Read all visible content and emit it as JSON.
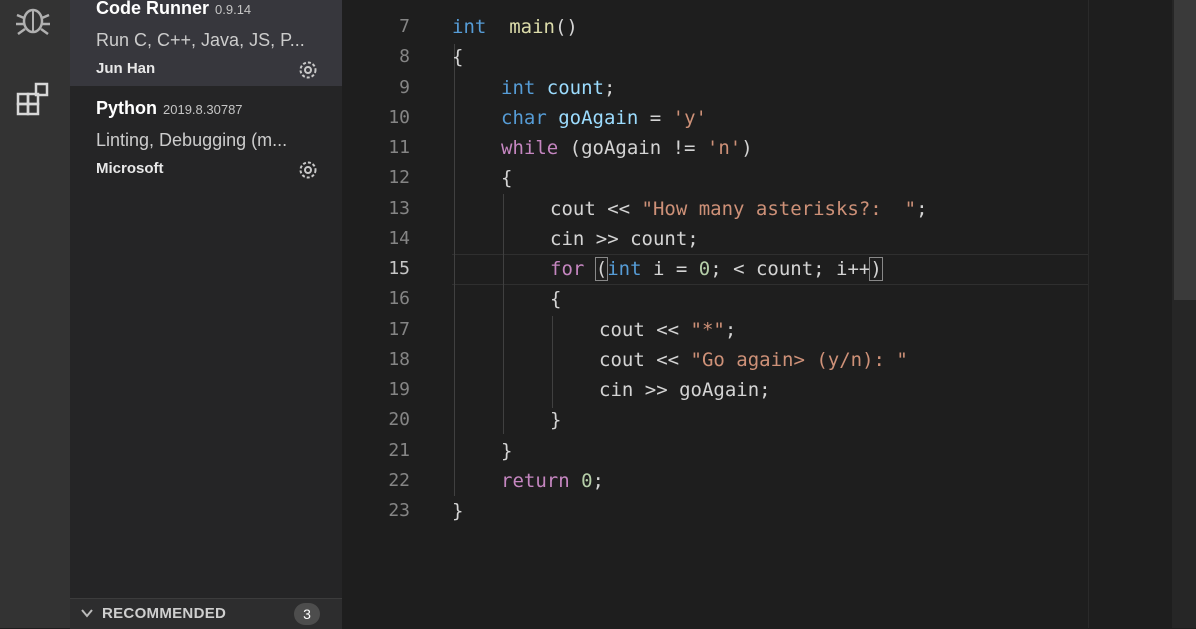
{
  "sidebar": {
    "extensions": [
      {
        "name": "Code Runner",
        "version": "0.9.14",
        "description": "Run C, C++, Java, JS, P...",
        "publisher": "Jun Han"
      },
      {
        "name": "Python",
        "version": "2019.8.30787",
        "description": "Linting, Debugging (m...",
        "publisher": "Microsoft"
      }
    ],
    "recommended": {
      "label": "RECOMMENDED",
      "count": "3"
    }
  },
  "editor": {
    "active_line": 15,
    "lines": [
      {
        "num": "7",
        "indent": 0,
        "tokens": [
          [
            "kw",
            "int"
          ],
          [
            "",
            "  "
          ],
          [
            "fn",
            "main"
          ],
          [
            "",
            "()"
          ]
        ]
      },
      {
        "num": "8",
        "indent": 0,
        "tokens": [
          [
            "",
            "{"
          ]
        ]
      },
      {
        "num": "9",
        "indent": 1,
        "tokens": [
          [
            "kw",
            "int"
          ],
          [
            "",
            " "
          ],
          [
            "var",
            "count"
          ],
          [
            "",
            ";"
          ]
        ]
      },
      {
        "num": "10",
        "indent": 1,
        "tokens": [
          [
            "kw",
            "char"
          ],
          [
            "",
            " "
          ],
          [
            "var",
            "goAgain"
          ],
          [
            "",
            " = "
          ],
          [
            "str",
            "'y'"
          ]
        ]
      },
      {
        "num": "11",
        "indent": 1,
        "tokens": [
          [
            "kw2",
            "while"
          ],
          [
            "",
            " (goAgain != "
          ],
          [
            "str",
            "'n'"
          ],
          [
            "",
            ")"
          ]
        ]
      },
      {
        "num": "12",
        "indent": 1,
        "tokens": [
          [
            "",
            "{"
          ]
        ]
      },
      {
        "num": "13",
        "indent": 2,
        "tokens": [
          [
            "",
            "cout << "
          ],
          [
            "str",
            "\"How many asterisks?:  \""
          ],
          [
            "",
            ";"
          ]
        ]
      },
      {
        "num": "14",
        "indent": 2,
        "tokens": [
          [
            "",
            "cin >> count;"
          ]
        ]
      },
      {
        "num": "15",
        "indent": 2,
        "tokens": [
          [
            "kw2",
            "for"
          ],
          [
            "",
            " "
          ],
          [
            "bracket",
            "("
          ],
          [
            "kw",
            "int"
          ],
          [
            "",
            " i = "
          ],
          [
            "num",
            "0"
          ],
          [
            "",
            "; < count; i++"
          ],
          [
            "bracket",
            ")"
          ]
        ]
      },
      {
        "num": "16",
        "indent": 2,
        "tokens": [
          [
            "",
            "{"
          ]
        ]
      },
      {
        "num": "17",
        "indent": 3,
        "tokens": [
          [
            "",
            "cout << "
          ],
          [
            "str",
            "\"*\""
          ],
          [
            "",
            ";"
          ]
        ]
      },
      {
        "num": "18",
        "indent": 3,
        "tokens": [
          [
            "",
            "cout << "
          ],
          [
            "str",
            "\"Go again> (y/n): \""
          ]
        ]
      },
      {
        "num": "19",
        "indent": 3,
        "tokens": [
          [
            "",
            "cin >> goAgain;"
          ]
        ]
      },
      {
        "num": "20",
        "indent": 2,
        "tokens": [
          [
            "",
            "}"
          ]
        ]
      },
      {
        "num": "21",
        "indent": 1,
        "tokens": [
          [
            "",
            "}"
          ]
        ]
      },
      {
        "num": "22",
        "indent": 1,
        "tokens": [
          [
            "kw2",
            "return"
          ],
          [
            "",
            " "
          ],
          [
            "num",
            "0"
          ],
          [
            "",
            ";"
          ]
        ]
      },
      {
        "num": "23",
        "indent": 0,
        "tokens": [
          [
            "",
            "}"
          ]
        ]
      }
    ]
  },
  "icons": {
    "debug": "bug-icon",
    "extensions": "extensions-icon",
    "manage": "gear-icon",
    "collapse": "chevron-down-icon"
  },
  "colors": {
    "keyword": "#569cd6",
    "control": "#c586c0",
    "function": "#dcdcaa",
    "variable": "#9cdcfe",
    "string": "#ce9178",
    "number": "#b5cea8"
  }
}
